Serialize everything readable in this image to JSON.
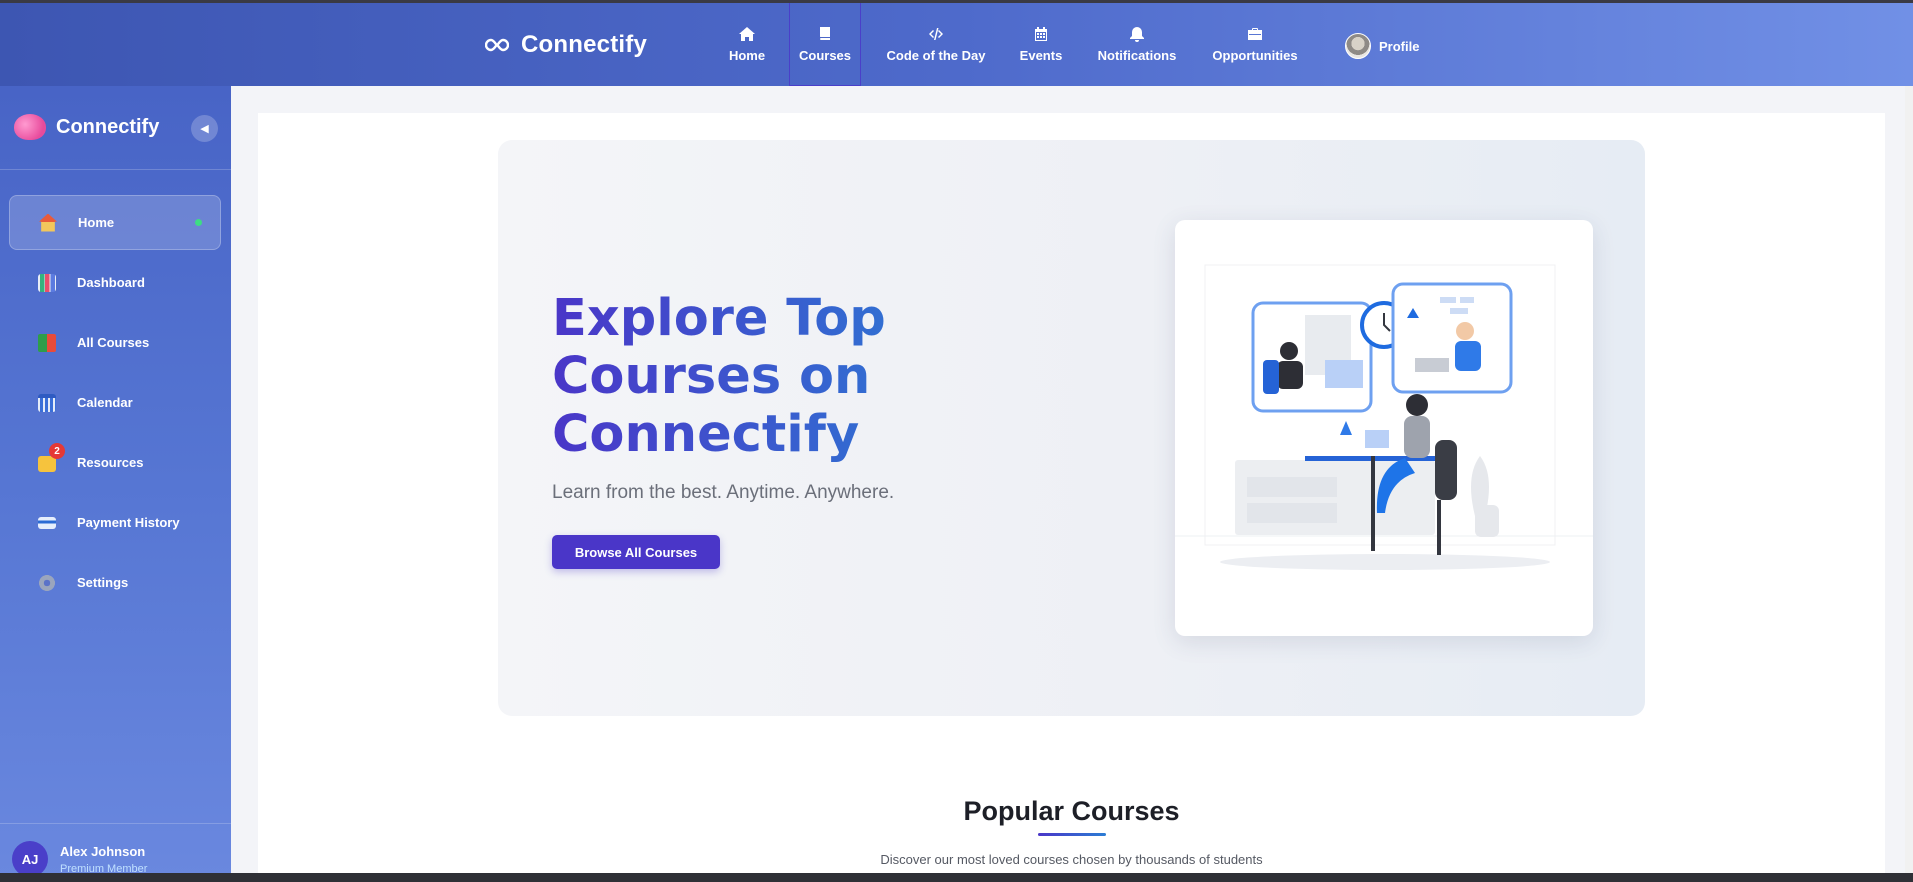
{
  "app": {
    "name": "Connectify"
  },
  "topnav": {
    "brand": "Connectify",
    "items": [
      {
        "label": "Home",
        "icon": "home-icon"
      },
      {
        "label": "Courses",
        "icon": "book-icon",
        "active": true
      },
      {
        "label": "Code of the Day",
        "icon": "code-icon"
      },
      {
        "label": "Events",
        "icon": "calendar-icon"
      },
      {
        "label": "Notifications",
        "icon": "bell-icon"
      },
      {
        "label": "Opportunities",
        "icon": "briefcase-icon"
      }
    ],
    "profile_label": "Profile"
  },
  "sidebar": {
    "brand": "Connectify",
    "items": [
      {
        "label": "Home",
        "icon": "house-icon",
        "active": true
      },
      {
        "label": "Dashboard",
        "icon": "chart-icon"
      },
      {
        "label": "All Courses",
        "icon": "books-icon"
      },
      {
        "label": "Calendar",
        "icon": "calendar-icon"
      },
      {
        "label": "Resources",
        "icon": "folder-icon",
        "badge": "2"
      },
      {
        "label": "Payment History",
        "icon": "credit-card-icon"
      },
      {
        "label": "Settings",
        "icon": "gear-icon"
      }
    ],
    "user": {
      "initials": "AJ",
      "name": "Alex Johnson",
      "role": "Premium Member"
    }
  },
  "hero": {
    "title": "Explore Top Courses on Connectify",
    "subtitle": "Learn from the best. Anytime. Anywhere.",
    "cta": "Browse All Courses"
  },
  "popular": {
    "title": "Popular Courses",
    "subtitle": "Discover our most loved courses chosen by thousands of students"
  },
  "colors": {
    "accent": "#4a36c8",
    "nav_start": "#3d56b2",
    "nav_end": "#7190e6",
    "online": "#3ddc84",
    "badge": "#e53935"
  }
}
